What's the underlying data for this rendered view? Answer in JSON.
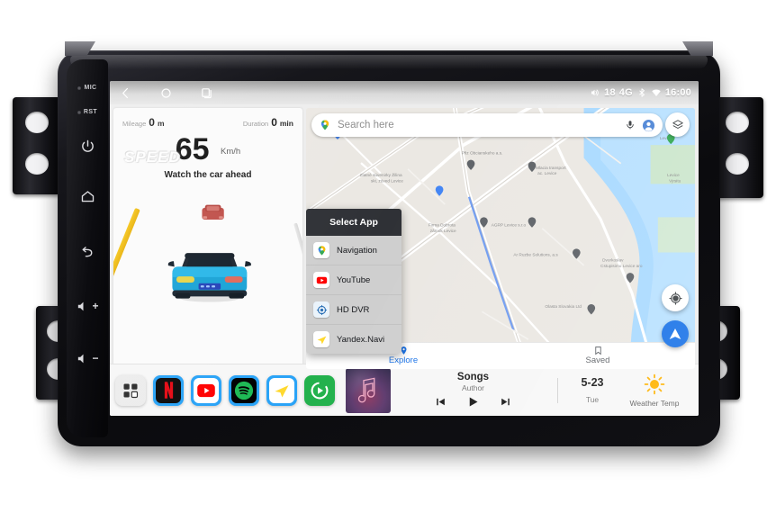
{
  "device": {
    "rail": {
      "mic_label": "MIC",
      "rst_label": "RST",
      "buttons": [
        "power-icon",
        "home-icon",
        "back-icon",
        "volume-up-icon",
        "volume-down-icon"
      ]
    }
  },
  "status_bar": {
    "nav": [
      "back-icon",
      "home-icon",
      "recents-icon"
    ],
    "volume_level": "18",
    "network": "4G",
    "bluetooth": "bluetooth-icon",
    "wifi": "wifi-icon",
    "clock": "16:00"
  },
  "adas": {
    "mileage_label": "Mileage",
    "mileage_value": "0",
    "mileage_unit": "m",
    "duration_label": "Duration",
    "duration_value": "0",
    "duration_unit": "min",
    "watermark": "SPEED",
    "speed_value": "65",
    "speed_unit": "Km/h",
    "warning": "Watch the car ahead"
  },
  "map": {
    "search_placeholder": "Search here",
    "search_icon": "google-maps-pin-icon",
    "mic_icon": "mic-icon",
    "account_icon": "account-avatar-icon",
    "layers_icon": "map-layers-icon",
    "locate_icon": "my-location-icon",
    "directions_icon": "directions-icon",
    "bottom_nav": [
      {
        "label": "Explore",
        "icon": "place-pin-icon",
        "active": true
      },
      {
        "label": "Saved",
        "icon": "bookmark-icon",
        "active": false
      }
    ],
    "accent_color": "#1a73e8"
  },
  "select_app_dialog": {
    "title": "Select App",
    "items": [
      {
        "label": "Navigation",
        "icon": "google-maps-icon"
      },
      {
        "label": "YouTube",
        "icon": "youtube-icon"
      },
      {
        "label": "HD DVR",
        "icon": "dvr-camera-icon"
      },
      {
        "label": "Yandex.Navi",
        "icon": "yandex-navi-icon"
      }
    ]
  },
  "dock": {
    "apps": [
      {
        "name": "all-apps-grid-icon",
        "label": ""
      },
      {
        "name": "netflix-icon",
        "label": "N"
      },
      {
        "name": "youtube-icon",
        "label": ""
      },
      {
        "name": "spotify-icon",
        "label": ""
      },
      {
        "name": "yandex-navi-icon",
        "label": ""
      },
      {
        "name": "autokit-play-icon",
        "label": ""
      }
    ]
  },
  "music": {
    "album_art_icon": "music-note-icon",
    "title": "Songs",
    "author": "Author",
    "prev_icon": "previous-track-icon",
    "play_icon": "play-icon",
    "next_icon": "next-track-icon"
  },
  "date": {
    "day": "5-23",
    "weekday": "Tue"
  },
  "weather": {
    "icon": "sun-icon",
    "label": "Weather Temp"
  }
}
